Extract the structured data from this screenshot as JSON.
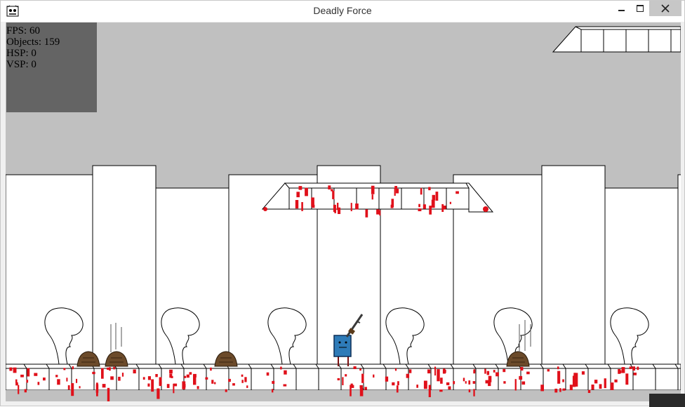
{
  "window": {
    "title": "Deadly Force",
    "icon": "game-app-icon",
    "controls": [
      "minimize-icon",
      "maximize-icon",
      "close-icon"
    ]
  },
  "hud": {
    "fps_label": "FPS: 60",
    "objects_label": "Objects: 159",
    "hsp_label": "HSP: 0",
    "vsp_label": "VSP: 0"
  },
  "scene": {
    "background_color": "#c0c0c0",
    "wall_color": "#ffffff",
    "outline_color": "#000000",
    "blood_color": "#e0101a",
    "player_color": "#2e7bb8",
    "mound_color": "#6b4a2a",
    "player_item": "rifle-icon"
  }
}
